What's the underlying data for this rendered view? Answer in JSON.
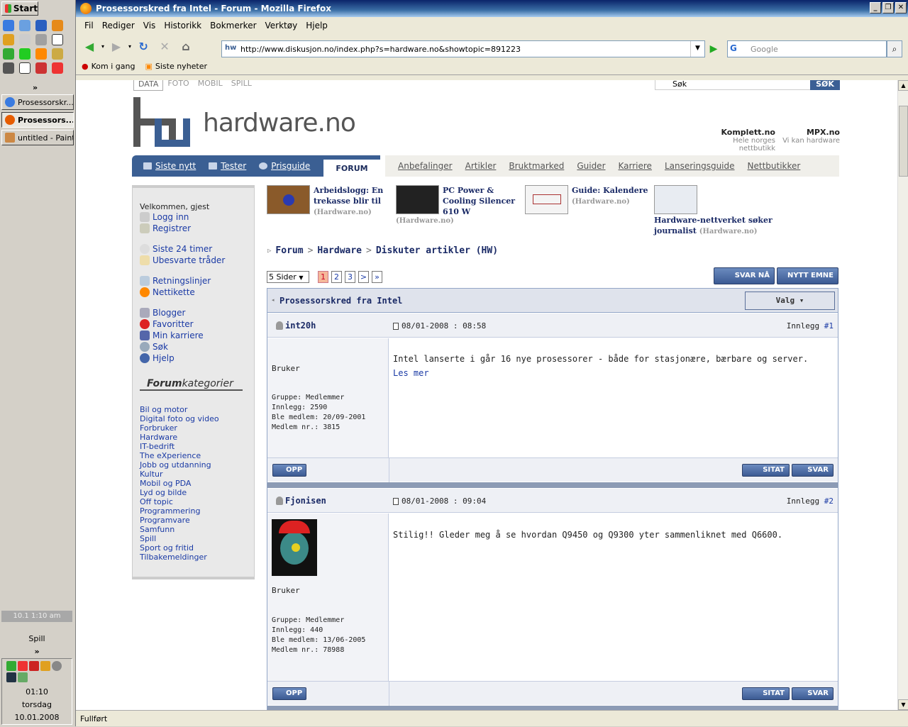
{
  "taskbar": {
    "start_label": "Start",
    "tasks": [
      "Prosessorskr...",
      "Prosessors...",
      "untitled - Paint"
    ],
    "clock_bar": "10.1   1:10 am",
    "spill": "Spill",
    "more": "»",
    "time": "01:10",
    "day": "torsdag",
    "date": "10.01.2008"
  },
  "browser": {
    "title": "Prosessorskred fra Intel - Forum - Mozilla Firefox",
    "menu": [
      "Fil",
      "Rediger",
      "Vis",
      "Historikk",
      "Bokmerker",
      "Verktøy",
      "Hjelp"
    ],
    "url": "http://www.diskusjon.no/index.php?s=hardware.no&showtopic=891223",
    "search_placeholder": "Google",
    "bookmarks": [
      "Kom i gang",
      "Siste nyheter"
    ],
    "status": "Fullført"
  },
  "site": {
    "top_tabs": [
      "DATA",
      "FOTO",
      "MOBIL",
      "SPILL"
    ],
    "search_value": "Søk",
    "search_btn": "SØK",
    "logo_text": "hardware.no",
    "partners": [
      {
        "name": "Komplett.no",
        "tag": "Hele norges nettbutikk"
      },
      {
        "name": "MPX.no",
        "tag": "Vi kan hardware"
      }
    ],
    "nav_left": [
      "Siste nytt",
      "Tester",
      "Prisguide"
    ],
    "forum_tab": "FORUM",
    "nav_right": [
      "Anbefalinger",
      "Artikler",
      "Bruktmarked",
      "Guider",
      "Karriere",
      "Lanseringsguide",
      "Nettbutikker"
    ]
  },
  "sidebar": {
    "welcome": "Velkommen, gjest",
    "links1": [
      "Logg inn",
      "Registrer"
    ],
    "links2": [
      "Siste 24 timer",
      "Ubesvarte tråder"
    ],
    "links3": [
      "Retningslinjer",
      "Nettikette"
    ],
    "links4": [
      "Blogger",
      "Favoritter",
      "Min karriere",
      "Søk",
      "Hjelp"
    ],
    "cat_head_a": "Forum",
    "cat_head_b": "kategorier",
    "categories": [
      "Bil og motor",
      "Digital foto og video",
      "Forbruker",
      "Hardware",
      "IT-bedrift",
      "The eXperience",
      "Jobb og utdanning",
      "Kultur",
      "Mobil og PDA",
      "Lyd og bilde",
      "Off topic",
      "Programmering",
      "Programvare",
      "Samfunn",
      "Spill",
      "Sport og fritid",
      "Tilbakemeldinger"
    ]
  },
  "teasers": [
    {
      "title": "Arbeidslogg: En trekasse blir til",
      "src": "(Hardware.no)"
    },
    {
      "title": "PC Power & Cooling Silencer 610 W",
      "src": "(Hardware.no)"
    },
    {
      "title": "Guide: Kalendere",
      "src": "(Hardware.no)"
    },
    {
      "title": "Hardware-nettverket søker journalist",
      "src": "(Hardware.no)"
    }
  ],
  "breadcrumb": [
    "Forum",
    "Hardware",
    "Diskuter artikler (HW)"
  ],
  "pager": {
    "select": "5 Sider",
    "pages": [
      "1",
      "2",
      "3",
      ">",
      "»"
    ]
  },
  "buttons": {
    "reply_now": "SVAR NÅ",
    "new_topic": "NYTT EMNE",
    "valg": "Valg ▾",
    "opp": "OPP",
    "sitat": "SITAT",
    "svar": "SVAR"
  },
  "topic_title": "Prosessorskred fra Intel",
  "posts": [
    {
      "author": "int20h",
      "date": "08/01-2008 : 08:58",
      "num_label": "Innlegg",
      "num": "#1",
      "role": "Bruker",
      "group": "Gruppe: Medlemmer",
      "count": "Innlegg: 2590",
      "joined": "Ble medlem: 20/09-2001",
      "member_no": "Medlem nr.: 3815",
      "body": "Intel lanserte i går 16 nye prosessorer - både for stasjonære, bærbare og server.",
      "link": "Les mer"
    },
    {
      "author": "Fjonisen",
      "date": "08/01-2008 : 09:04",
      "num_label": "Innlegg",
      "num": "#2",
      "role": "Bruker",
      "group": "Gruppe: Medlemmer",
      "count": "Innlegg: 440",
      "joined": "Ble medlem: 13/06-2005",
      "member_no": "Medlem nr.: 78988",
      "body": "Stilig!! Gleder meg å se hvordan Q9450 og Q9300 yter sammenliknet med Q6600."
    }
  ]
}
